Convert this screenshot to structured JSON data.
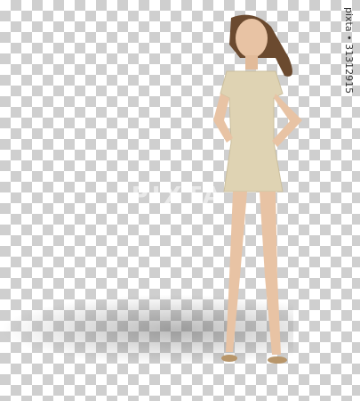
{
  "image": {
    "watermark": "PIXTA",
    "stock_id": "pixta • 31312915"
  }
}
